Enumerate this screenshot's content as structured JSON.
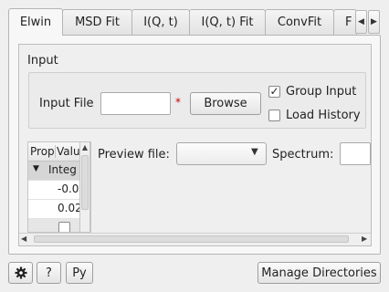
{
  "tabs": [
    {
      "label": "Elwin",
      "active": true
    },
    {
      "label": "MSD Fit"
    },
    {
      "label": "I(Q, t)"
    },
    {
      "label": "I(Q, t) Fit"
    },
    {
      "label": "ConvFit"
    },
    {
      "label": "F"
    }
  ],
  "input_section": {
    "title": "Input",
    "input_file_label": "Input File",
    "input_file_value": "",
    "required_marker": "*",
    "browse_label": "Browse",
    "group_input_label": "Group Input",
    "group_input_checked": true,
    "load_history_label": "Load History",
    "load_history_checked": false
  },
  "property_table": {
    "col_property": "Prop",
    "col_value": "Valu",
    "group_label": "Integ",
    "rows": [
      "-0.0",
      "0.02"
    ]
  },
  "preview": {
    "preview_file_label": "Preview file:",
    "preview_file_value": "",
    "spectrum_label": "Spectrum:",
    "spectrum_value": ""
  },
  "footer": {
    "help_label": "?",
    "python_label": "Py",
    "manage_directories_label": "Manage Directories"
  },
  "colors": {
    "required_marker": "#cc0000",
    "background": "#efefef"
  }
}
